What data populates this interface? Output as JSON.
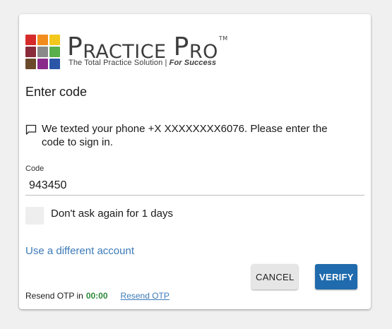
{
  "logo": {
    "title_first_initial": "P",
    "title_first_rest": "RACTICE",
    "title_second_initial": "P",
    "title_second_rest": "RO",
    "trademark": "TM",
    "tagline": "The Total Practice Solution | ",
    "tagline_emphasis": "For Success",
    "tile_colors": [
      "#d62b2b",
      "#f28c1c",
      "#f2c81c",
      "#8b2a3a",
      "#8a8a8a",
      "#59b04a",
      "#6b4a2b",
      "#8a2a8a",
      "#2b56a8"
    ]
  },
  "page": {
    "heading": "Enter code",
    "message_icon": "chat-bubble-icon",
    "message": "We texted your phone +X XXXXXXXX6076. Please enter the code to sign in."
  },
  "code_field": {
    "label": "Code",
    "value": "943450"
  },
  "remember": {
    "checked": false,
    "label": "Don't ask again for 1 days"
  },
  "links": {
    "different_account": "Use a different account"
  },
  "buttons": {
    "cancel": "CANCEL",
    "verify": "VERIFY"
  },
  "resend": {
    "prefix": "Resend OTP in",
    "timer": "00:00",
    "link": "Resend OTP"
  },
  "colors": {
    "link": "#3d7ab8",
    "verify_button": "#1f6bad",
    "timer": "#2e8b3a"
  }
}
